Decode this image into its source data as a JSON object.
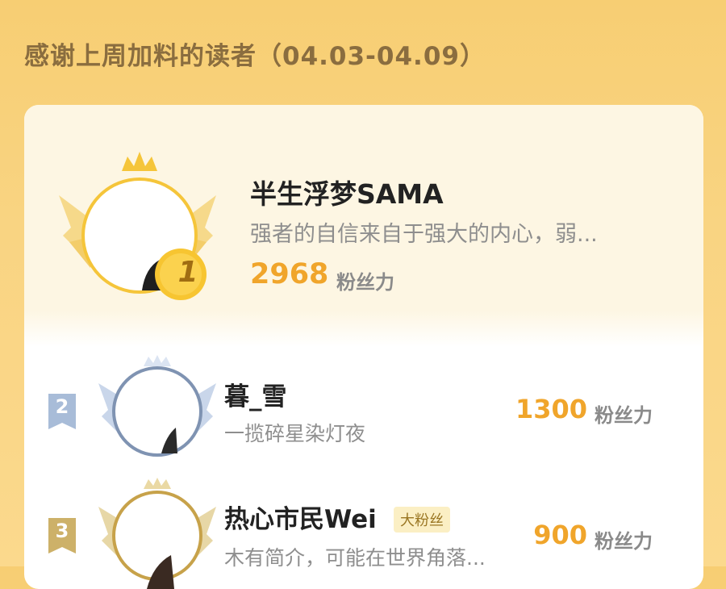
{
  "header": {
    "title": "感谢上周加料的读者（04.03-04.09）"
  },
  "ranking": [
    {
      "rank": "1",
      "name": "半生浮梦SAMA",
      "bio": "强者的自信来自于强大的内心，弱...",
      "score": "2968",
      "unit": "粉丝力"
    },
    {
      "rank": "2",
      "name": "暮_雪",
      "bio": "一揽碎星染灯夜",
      "score": "1300",
      "unit": "粉丝力"
    },
    {
      "rank": "3",
      "name": "热心市民Wei",
      "badge": "大粉丝",
      "bio": "木有简介，可能在世界角落...",
      "score": "900",
      "unit": "粉丝力"
    }
  ],
  "colors": {
    "background": "#f8d07a",
    "accent": "#f0a52b",
    "gold": "#f5c53a",
    "silver": "#7f93b2",
    "bronze": "#c7a24a"
  }
}
